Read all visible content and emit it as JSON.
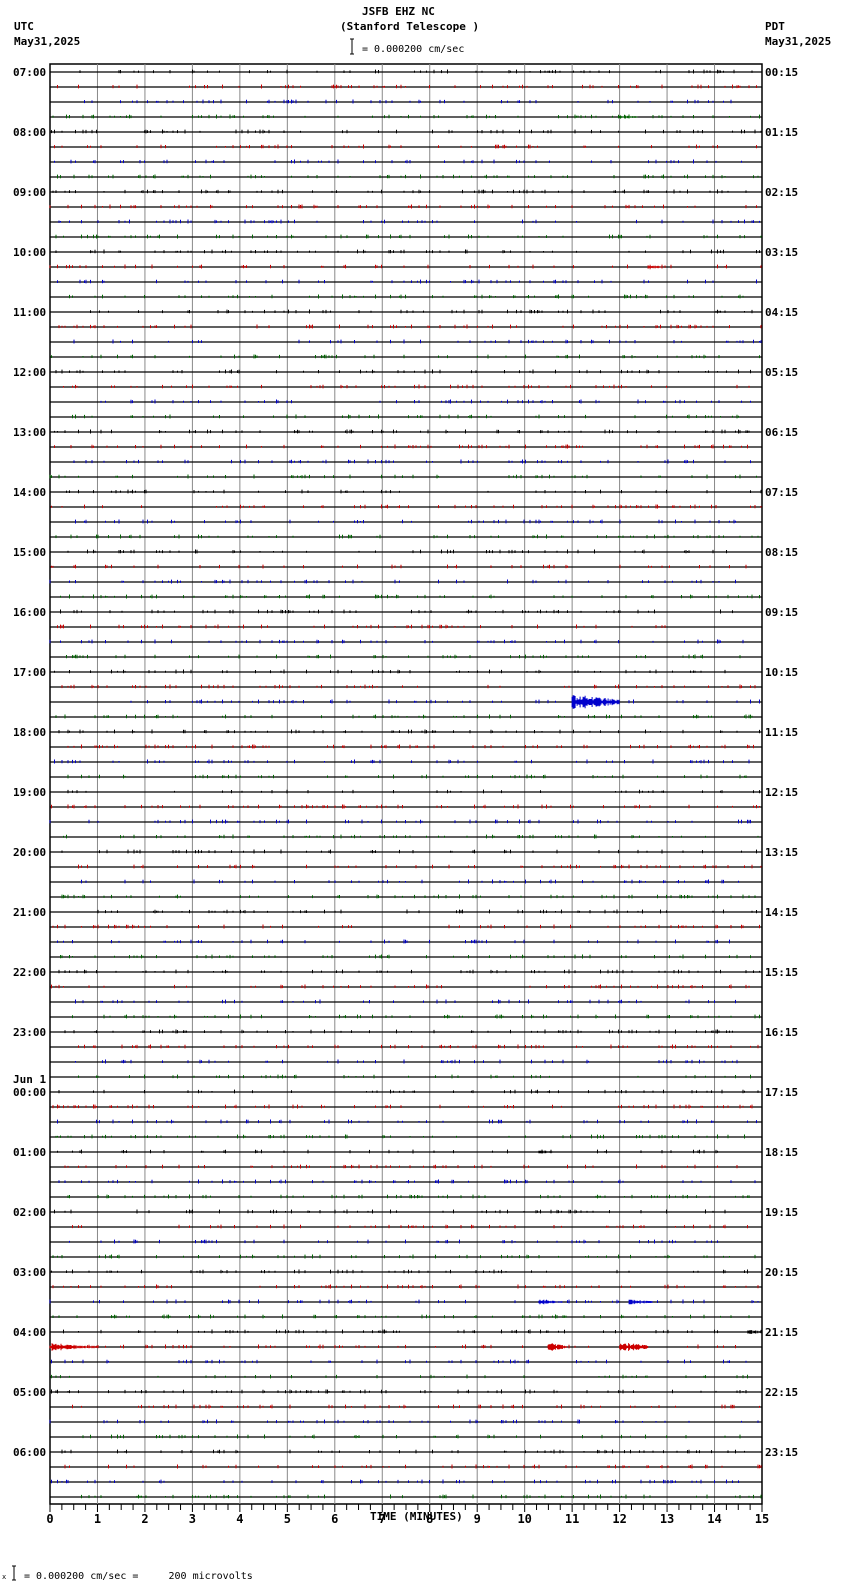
{
  "header": {
    "station": "JSFB EHZ NC",
    "site": "(Stanford Telescope )",
    "left_tz": "UTC",
    "left_date": "May31,2025",
    "right_tz": "PDT",
    "right_date": "May31,2025",
    "scale_text": "= 0.000200 cm/sec"
  },
  "footer": {
    "scale_text": "= 0.000200 cm/sec =     200 microvolts"
  },
  "chart_data": {
    "type": "line",
    "subtype": "helicorder",
    "xlabel": "TIME (MINUTES)",
    "xlim": [
      0,
      15
    ],
    "x_ticks": [
      "0",
      "1",
      "2",
      "3",
      "4",
      "5",
      "6",
      "7",
      "8",
      "9",
      "10",
      "11",
      "12",
      "13",
      "14",
      "15"
    ],
    "trace_colors": [
      "#000000",
      "#cc0000",
      "#0000cc",
      "#006600"
    ],
    "traces_per_hour": 4,
    "left_labels": [
      "07:00",
      "08:00",
      "09:00",
      "10:00",
      "11:00",
      "12:00",
      "13:00",
      "14:00",
      "15:00",
      "16:00",
      "17:00",
      "18:00",
      "19:00",
      "20:00",
      "21:00",
      "22:00",
      "23:00",
      "00:00",
      "01:00",
      "02:00",
      "03:00",
      "04:00",
      "05:00",
      "06:00"
    ],
    "left_date_change": {
      "hour_index": 17,
      "label": "Jun 1"
    },
    "right_labels": [
      "00:15",
      "01:15",
      "02:15",
      "03:15",
      "04:15",
      "05:15",
      "06:15",
      "07:15",
      "08:15",
      "09:15",
      "10:15",
      "11:15",
      "12:15",
      "13:15",
      "14:15",
      "15:15",
      "16:15",
      "17:15",
      "18:15",
      "19:15",
      "20:15",
      "21:15",
      "22:15",
      "23:15"
    ],
    "events": [
      {
        "trace": 42,
        "start_min": 11.0,
        "end_min": 12.0,
        "amplitude": 6
      },
      {
        "trace": 85,
        "start_min": 0.0,
        "end_min": 1.0,
        "amplitude": 3
      },
      {
        "trace": 85,
        "start_min": 10.5,
        "end_min": 10.9,
        "amplitude": 4
      },
      {
        "trace": 85,
        "start_min": 12.0,
        "end_min": 12.6,
        "amplitude": 4
      },
      {
        "trace": 82,
        "start_min": 10.3,
        "end_min": 10.8,
        "amplitude": 2
      },
      {
        "trace": 82,
        "start_min": 12.2,
        "end_min": 12.7,
        "amplitude": 2
      },
      {
        "trace": 84,
        "start_min": 14.7,
        "end_min": 15.0,
        "amplitude": 2
      },
      {
        "trace": 13,
        "start_min": 12.6,
        "end_min": 12.9,
        "amplitude": 2
      },
      {
        "trace": 72,
        "start_min": 10.3,
        "end_min": 10.6,
        "amplitude": 1.5
      },
      {
        "trace": 3,
        "start_min": 12.0,
        "end_min": 12.4,
        "amplitude": 1.5
      }
    ]
  }
}
